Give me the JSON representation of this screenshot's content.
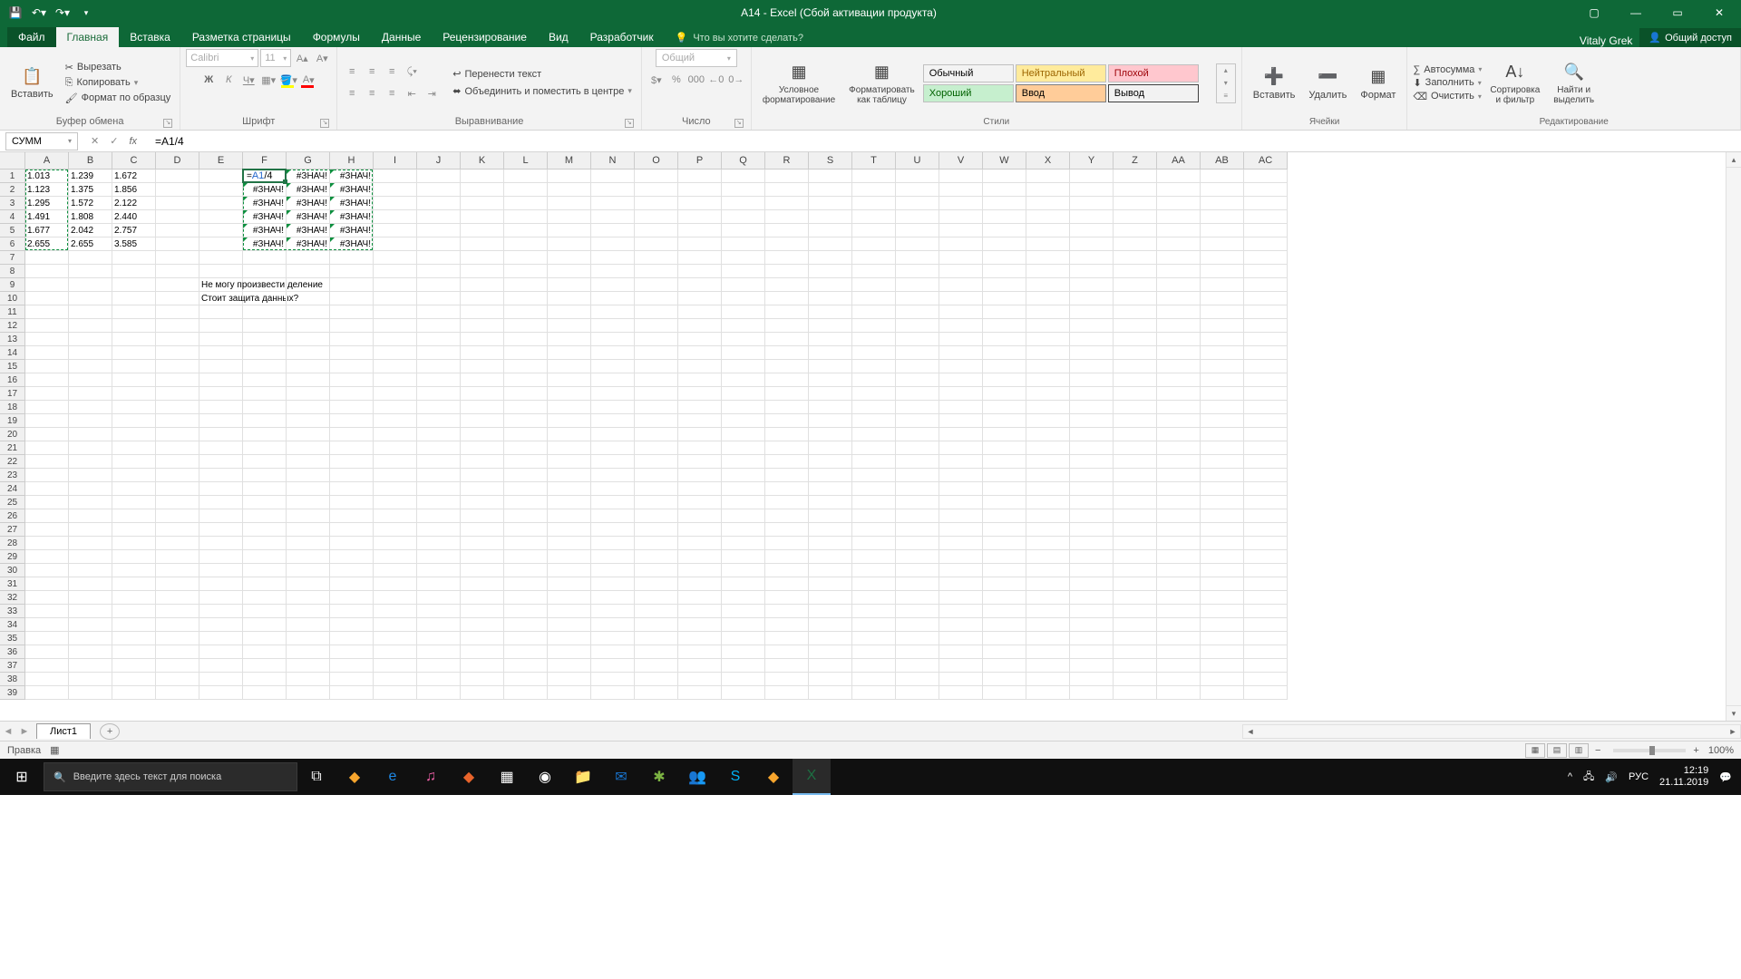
{
  "title": "A14 - Excel (Сбой активации продукта)",
  "user": "Vitaly Grek",
  "share": "Общий доступ",
  "tellme": "Что вы хотите сделать?",
  "tabs": {
    "file": "Файл",
    "home": "Главная",
    "insert": "Вставка",
    "layout": "Разметка страницы",
    "formulas": "Формулы",
    "data": "Данные",
    "review": "Рецензирование",
    "view": "Вид",
    "dev": "Разработчик"
  },
  "ribbon": {
    "clipboard": {
      "name": "Буфер обмена",
      "paste": "Вставить",
      "cut": "Вырезать",
      "copy": "Копировать",
      "fmt": "Формат по образцу"
    },
    "font": {
      "name": "Шрифт",
      "family": "Calibri",
      "size": "11"
    },
    "align": {
      "name": "Выравнивание",
      "wrap": "Перенести текст",
      "merge": "Объединить и поместить в центре"
    },
    "number": {
      "name": "Число",
      "fmt": "Общий"
    },
    "cond": {
      "name": "Стили",
      "cf": "Условное\nформатирование",
      "tbl": "Форматировать\nкак таблицу"
    },
    "styles": {
      "s1": "Обычный",
      "s2": "Нейтральный",
      "s3": "Плохой",
      "s4": "Хороший",
      "s5": "Ввод",
      "s6": "Вывод"
    },
    "cells": {
      "name": "Ячейки",
      "ins": "Вставить",
      "del": "Удалить",
      "fmt": "Формат"
    },
    "edit": {
      "name": "Редактирование",
      "sum": "Автосумма",
      "fill": "Заполнить",
      "clear": "Очистить",
      "sort": "Сортировка\nи фильтр",
      "find": "Найти и\nвыделить"
    }
  },
  "namebox": "СУММ",
  "formula": "=A1/4",
  "formula_ref": "A1",
  "formula_rest": "/4",
  "columns": [
    "A",
    "B",
    "C",
    "D",
    "E",
    "F",
    "G",
    "H",
    "I",
    "J",
    "K",
    "L",
    "M",
    "N",
    "O",
    "P",
    "Q",
    "R",
    "S",
    "T",
    "U",
    "V",
    "W",
    "X",
    "Y",
    "Z",
    "AA",
    "AB",
    "AC"
  ],
  "err": "#ЗНАЧ!",
  "data_abc": [
    [
      "1.013",
      "1.239",
      "1.672"
    ],
    [
      "1.123",
      "1.375",
      "1.856"
    ],
    [
      "1.295",
      "1.572",
      "2.122"
    ],
    [
      "1.491",
      "1.808",
      "2.440"
    ],
    [
      "1.677",
      "2.042",
      "2.757"
    ],
    [
      "2.655",
      "2.655",
      "3.585"
    ]
  ],
  "inplace": "=A1/4",
  "memo1": "Не могу произвести деление",
  "memo2": "Стоит защита данных?",
  "sheet": "Лист1",
  "status": "Правка",
  "zoom": "100%",
  "taskbar": {
    "search": "Введите здесь текст для поиска",
    "lang": "РУС",
    "time": "12:19",
    "date": "21.11.2019"
  }
}
